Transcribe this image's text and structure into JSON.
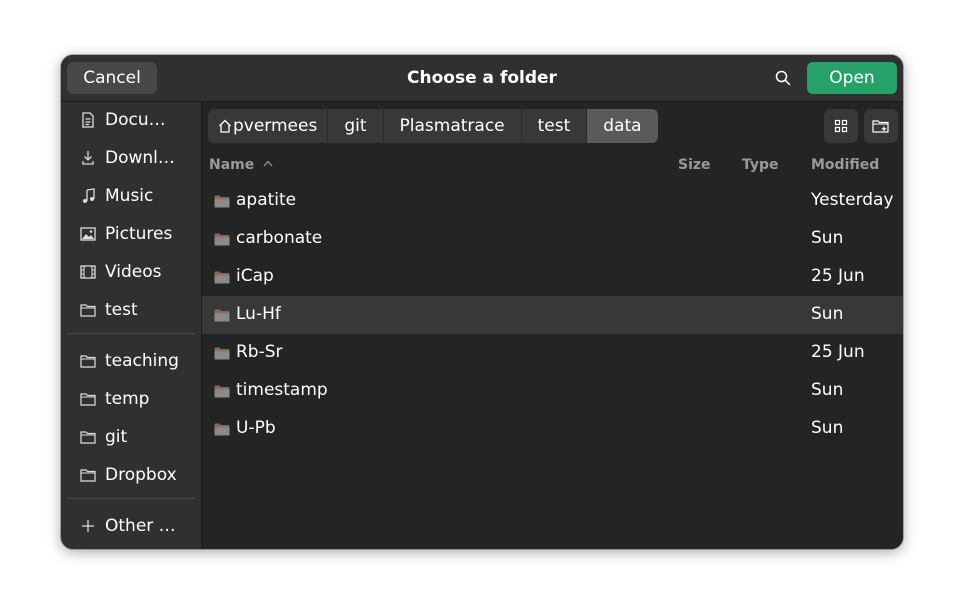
{
  "dialog": {
    "title": "Choose a folder",
    "cancel_label": "Cancel",
    "open_label": "Open",
    "accent_color": "#26a269"
  },
  "sidebar": {
    "items": [
      {
        "label": "Documents",
        "display": "Docu…",
        "icon": "document-icon"
      },
      {
        "label": "Downloads",
        "display": "Downl…",
        "icon": "download-icon"
      },
      {
        "label": "Music",
        "display": "Music",
        "icon": "music-icon"
      },
      {
        "label": "Pictures",
        "display": "Pictures",
        "icon": "picture-icon"
      },
      {
        "label": "Videos",
        "display": "Videos",
        "icon": "video-icon"
      },
      {
        "label": "test",
        "display": "test",
        "icon": "folder-icon"
      }
    ],
    "bookmarks": [
      {
        "label": "teaching",
        "icon": "folder-icon"
      },
      {
        "label": "temp",
        "icon": "folder-icon"
      },
      {
        "label": "git",
        "icon": "folder-icon"
      },
      {
        "label": "Dropbox",
        "icon": "folder-icon"
      }
    ],
    "other": {
      "display": "Other …",
      "icon": "plus-icon"
    }
  },
  "pathbar": {
    "crumbs": [
      "pvermees",
      "git",
      "Plasmatrace",
      "test",
      "data"
    ]
  },
  "columns": {
    "name": "Name",
    "size": "Size",
    "type": "Type",
    "modified": "Modified"
  },
  "files": [
    {
      "name": "apatite",
      "modified": "Yesterday"
    },
    {
      "name": "carbonate",
      "modified": "Sun"
    },
    {
      "name": "iCap",
      "modified": "25 Jun"
    },
    {
      "name": "Lu-Hf",
      "modified": "Sun",
      "selected": true
    },
    {
      "name": "Rb-Sr",
      "modified": "25 Jun"
    },
    {
      "name": "timestamp",
      "modified": "Sun"
    },
    {
      "name": "U-Pb",
      "modified": "Sun"
    }
  ]
}
